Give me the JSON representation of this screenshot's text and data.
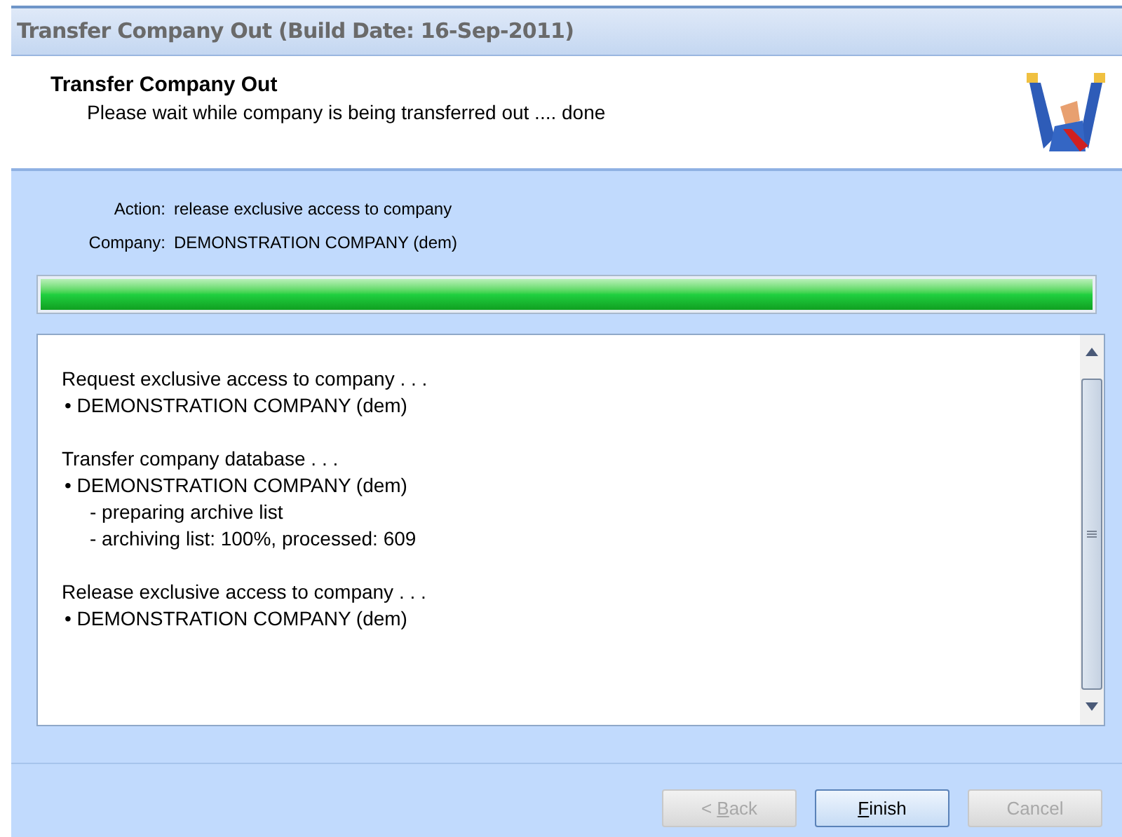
{
  "window": {
    "title": "Transfer Company Out (Build Date: 16-Sep-2011)"
  },
  "header": {
    "title": "Transfer Company Out",
    "subtitle": "Please wait while company is being transferred out .... done"
  },
  "fields": [
    {
      "label": "Action:",
      "value": "release exclusive access to company"
    },
    {
      "label": "Company:",
      "value": "DEMONSTRATION COMPANY (dem)"
    }
  ],
  "progress": {
    "level": 1
  },
  "log": [
    {
      "text": "Request exclusive access to company . . .",
      "children": [
        {
          "text": "• DEMONSTRATION COMPANY (dem)"
        }
      ]
    },
    {
      "text": "Transfer company database . . .",
      "children": [
        {
          "text": "• DEMONSTRATION COMPANY (dem)",
          "children": [
            {
              "text": "- preparing archive list"
            },
            {
              "text": "- archiving list: 100%, processed: 609"
            }
          ]
        }
      ]
    },
    {
      "text": "Release exclusive access to company . . .",
      "children": [
        {
          "text": "• DEMONSTRATION COMPANY (dem)"
        }
      ]
    }
  ],
  "buttons": [
    {
      "before": "< ",
      "mnemonic": "B",
      "after": "ack",
      "disabled": true
    },
    {
      "mnemonic": "F",
      "after": "inish",
      "disabled": false
    },
    {
      "after": "Cancel",
      "disabled": true
    }
  ]
}
